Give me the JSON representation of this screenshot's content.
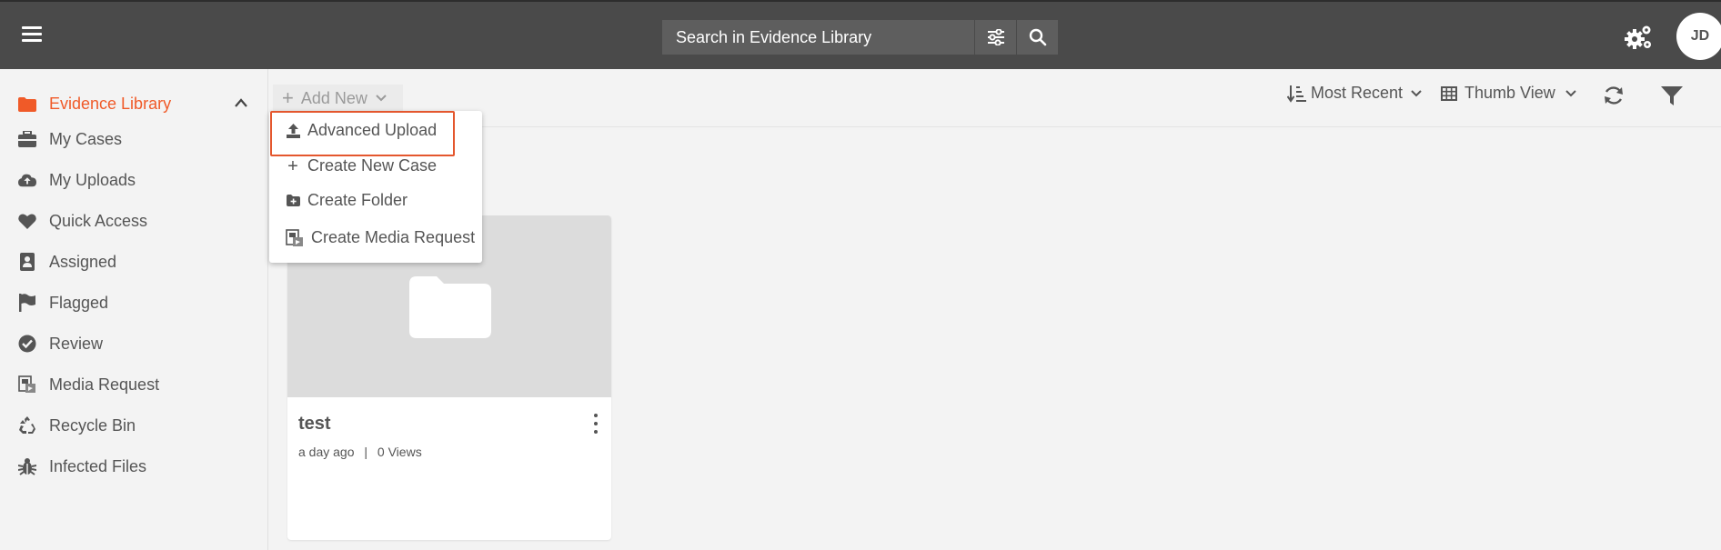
{
  "header": {
    "search_placeholder": "Search in Evidence Library",
    "avatar_initials": "JD"
  },
  "sidebar": {
    "head_label": "Evidence Library",
    "items": [
      {
        "label": "My Cases",
        "icon": "briefcase-icon"
      },
      {
        "label": "My Uploads",
        "icon": "cloud-upload-icon"
      },
      {
        "label": "Quick Access",
        "icon": "heart-icon"
      },
      {
        "label": "Assigned",
        "icon": "contact-card-icon"
      },
      {
        "label": "Flagged",
        "icon": "flag-icon"
      },
      {
        "label": "Review",
        "icon": "check-circle-icon"
      },
      {
        "label": "Media Request",
        "icon": "media-request-icon"
      },
      {
        "label": "Recycle Bin",
        "icon": "recycle-icon"
      },
      {
        "label": "Infected Files",
        "icon": "bug-icon"
      }
    ]
  },
  "toolbar": {
    "add_new_label": "Add New",
    "sort_label": "Most Recent",
    "view_label": "Thumb View"
  },
  "add_menu": {
    "items": [
      {
        "label": "Advanced Upload",
        "icon": "upload-icon"
      },
      {
        "label": "Create New Case",
        "icon": "plus-icon"
      },
      {
        "label": "Create Folder",
        "icon": "folder-plus-icon"
      },
      {
        "label": "Create Media Request",
        "icon": "media-request-icon"
      }
    ]
  },
  "cards": [
    {
      "title": "test",
      "time": "a day ago",
      "separator": "|",
      "views": "0 Views"
    }
  ],
  "colors": {
    "accent": "#f05a28",
    "topbar": "#4a4a4a",
    "highlight": "#e4572e"
  }
}
